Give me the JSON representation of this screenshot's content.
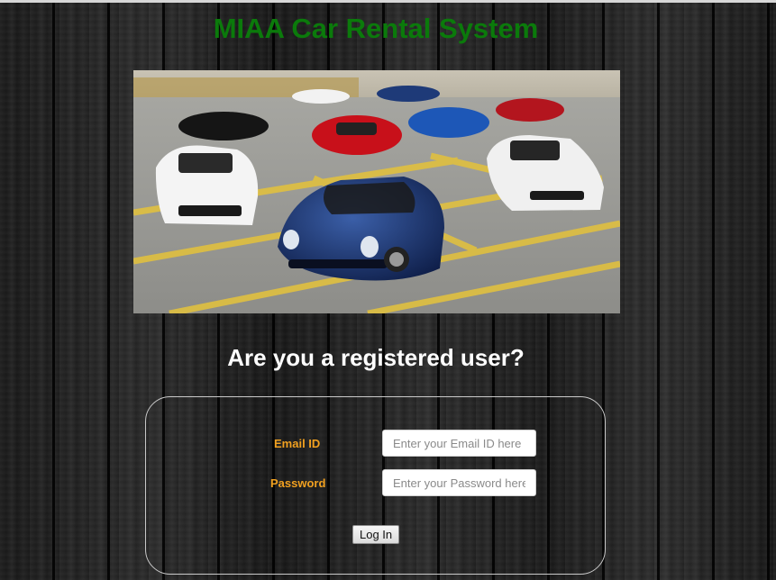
{
  "page": {
    "title": "MIAA Car Rental System",
    "title_color": "#0b7a0b"
  },
  "hero": {
    "image_subject": "cars-parked-on-tarmac"
  },
  "login": {
    "heading": "Are you a registered user?",
    "email_label": "Email ID",
    "email_placeholder": "Enter your Email ID here",
    "email_value": "",
    "password_label": "Password",
    "password_placeholder": "Enter your Password here",
    "password_value": "",
    "submit_label": "Log In",
    "label_color": "#f0a020"
  }
}
